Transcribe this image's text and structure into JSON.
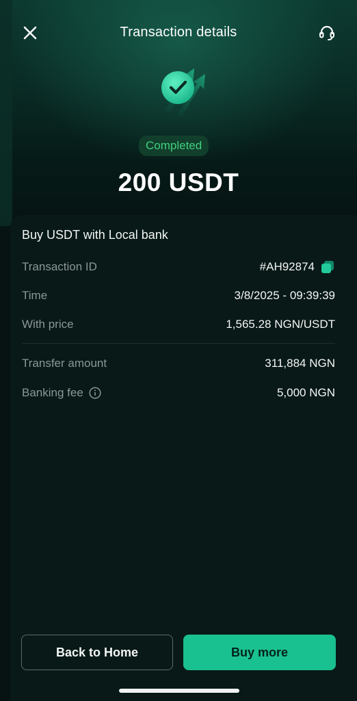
{
  "header": {
    "title": "Transaction details",
    "close_icon": "close-icon",
    "support_icon": "headset-icon"
  },
  "hero": {
    "icon": "check-circle-with-arrows-icon",
    "status": "Completed",
    "amount": "200 USDT"
  },
  "details": {
    "title": "Buy USDT with Local bank",
    "rows": [
      {
        "label": "Transaction ID",
        "value": "#AH92874"
      },
      {
        "label": "Time",
        "value": "3/8/2025 - 09:39:39"
      },
      {
        "label": "With price",
        "value": "1,565.28 NGN/USDT"
      },
      {
        "label": "Transfer amount",
        "value": "311,884 NGN"
      },
      {
        "label": "Banking fee",
        "value": "5,000 NGN"
      }
    ]
  },
  "buttons": {
    "back_home": "Back to Home",
    "buy_more": "Buy more"
  },
  "colors": {
    "accent": "#19c190",
    "status_green": "#3fd07d",
    "background": "#061312"
  }
}
